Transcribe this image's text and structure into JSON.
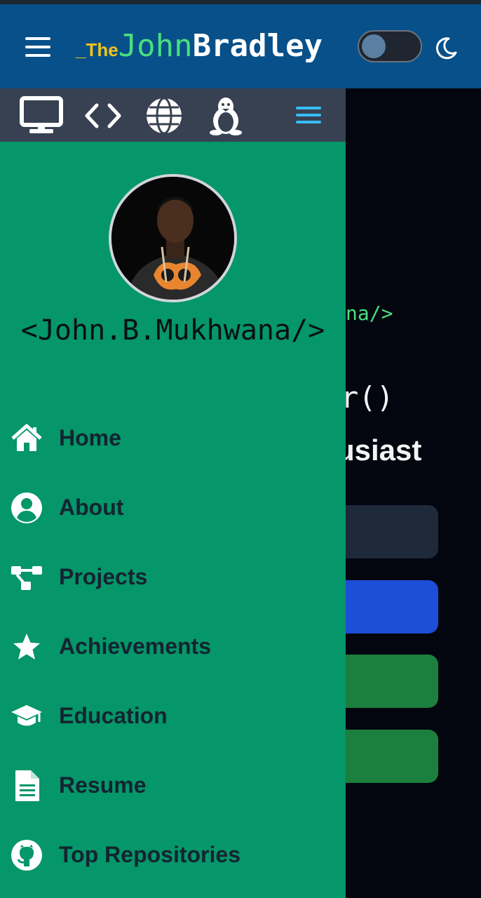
{
  "header": {
    "brand_prefix": "_The",
    "brand_first": "John",
    "brand_last": "Bradley"
  },
  "background": {
    "handle_fragment": "na/>",
    "function_fragment": "r()",
    "title_fragment": "usiast"
  },
  "drawer": {
    "username": "<John.B.Mukhwana/>",
    "menu": [
      {
        "label": "Home",
        "icon": "home-icon"
      },
      {
        "label": "About",
        "icon": "user-circle-icon"
      },
      {
        "label": "Projects",
        "icon": "project-diagram-icon"
      },
      {
        "label": "Achievements",
        "icon": "star-icon"
      },
      {
        "label": "Education",
        "icon": "graduation-cap-icon"
      },
      {
        "label": "Resume",
        "icon": "file-icon"
      },
      {
        "label": "Top Repositories",
        "icon": "github-icon"
      }
    ]
  },
  "colors": {
    "header_bg": "#075089",
    "drawer_bg": "#059669",
    "iconbar_bg": "#374151",
    "brand_yellow": "#f0c419",
    "brand_green": "#4ade80",
    "button_dark": "#1e2939",
    "button_blue": "#1d4ed8",
    "button_green": "#1b7f3e"
  }
}
